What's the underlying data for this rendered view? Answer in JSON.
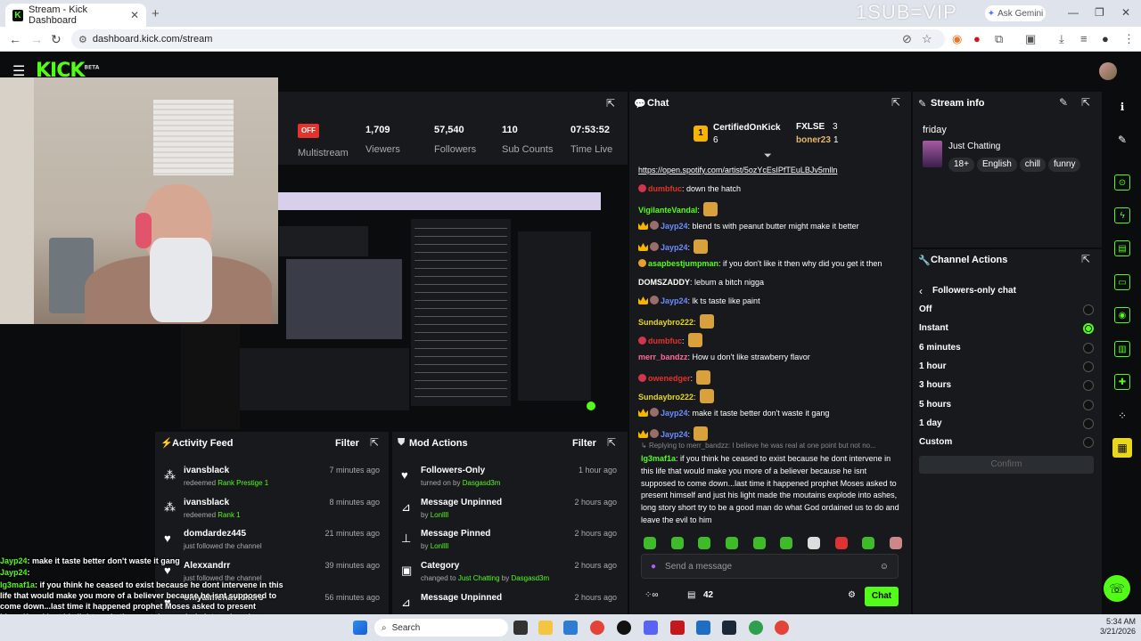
{
  "browser": {
    "tab_title": "Stream - Kick Dashboard",
    "url": "dashboard.kick.com/stream",
    "overlay_text": "1SUB=VIP",
    "gemini_label": "Ask Gemini"
  },
  "kick": {
    "logo": "KICK",
    "logo_sup": "BETA"
  },
  "stats": [
    {
      "value": "OFF",
      "label": "Multistream"
    },
    {
      "value": "1,709",
      "label": "Viewers"
    },
    {
      "value": "57,540",
      "label": "Followers"
    },
    {
      "value": "110",
      "label": "Sub Counts"
    },
    {
      "value": "07:53:52",
      "label": "Time Live"
    }
  ],
  "activity_feed": {
    "title": "Activity Feed",
    "filter": "Filter",
    "items": [
      {
        "name": "ivansblack",
        "time": "7 minutes ago",
        "sub_prefix": "redeemed",
        "sub_highlight": "Rank Prestige 1",
        "icon": "redeem-icon"
      },
      {
        "name": "ivansblack",
        "time": "8 minutes ago",
        "sub_prefix": "redeemed",
        "sub_highlight": "Rank 1",
        "icon": "redeem-icon"
      },
      {
        "name": "domdardez445",
        "time": "21 minutes ago",
        "sub_prefix": "just followed the channel",
        "sub_highlight": "",
        "icon": "heart-icon"
      },
      {
        "name": "Alexxandrr",
        "time": "39 minutes ago",
        "sub_prefix": "just followed the channel",
        "sub_highlight": "",
        "icon": "heart-icon"
      },
      {
        "name": "onlyaimenavickers",
        "time": "56 minutes ago",
        "sub_prefix": "",
        "sub_highlight": "",
        "icon": "heart-icon"
      }
    ]
  },
  "mod_actions": {
    "title": "Mod Actions",
    "filter": "Filter",
    "items": [
      {
        "name": "Followers-Only",
        "time": "1 hour ago",
        "sub_prefix": "turned on by",
        "sub_highlight": "Dasgasd3m",
        "sub_mid": "",
        "sub_highlight2": ""
      },
      {
        "name": "Message Unpinned",
        "time": "2 hours ago",
        "sub_prefix": "by",
        "sub_highlight": "Lonllll",
        "sub_mid": "",
        "sub_highlight2": ""
      },
      {
        "name": "Message Pinned",
        "time": "2 hours ago",
        "sub_prefix": "by",
        "sub_highlight": "Lonllll",
        "sub_mid": "",
        "sub_highlight2": ""
      },
      {
        "name": "Category",
        "time": "2 hours ago",
        "sub_prefix": "changed to",
        "sub_highlight": "Just Chatting",
        "sub_mid": "by",
        "sub_highlight2": "Dasgasd3m"
      },
      {
        "name": "Message Unpinned",
        "time": "2 hours ago",
        "sub_prefix": "",
        "sub_highlight": "",
        "sub_mid": "",
        "sub_highlight2": ""
      }
    ]
  },
  "overlay_chat": [
    {
      "user": "Jayp24",
      "text": ": make it taste better don't waste it gang"
    },
    {
      "user": "Jayp24",
      "text": ":"
    },
    {
      "user": "lg3maf1a",
      "text": ": if you think he ceased to exist because he dont intervene in this life that would make you more of a believer because he isnt supposed to come down...last time it happened prophet Moses asked to present himself and just his light made the moutains explode into ashes, long story short try to be a good man do what God ordained us to do and leave the evil to him"
    }
  ],
  "chat": {
    "title": "Chat",
    "top": [
      {
        "rank": "1",
        "name": "CertifiedOnKick",
        "count": "6"
      },
      {
        "name": "FXLSE",
        "count": "3"
      },
      {
        "name": "boner23",
        "count": "1"
      }
    ],
    "messages": [
      {
        "user": "",
        "color": "#ffffff",
        "text": "https://open.spotify.com/artist/5ozYcEsIPfTEuLBJv5mlln",
        "link": true
      },
      {
        "user": "dumbfuc",
        "color": "#e5322b",
        "text": ": down the hatch"
      },
      {
        "user": "VigilanteVandal",
        "color": "#53fc18",
        "text": ":"
      },
      {
        "user": "Jayp24",
        "color": "#6f8cff",
        "text": ": blend ts with peanut butter might make it better"
      },
      {
        "user": "Jayp24",
        "color": "#6f8cff",
        "text": ":"
      },
      {
        "user": "asapbestjumpman",
        "color": "#53fc18",
        "text": ": if you don't like it then why did you get it then"
      },
      {
        "user": "DOMSZADDY",
        "color": "#ffffff",
        "text": ": lebum a bitch nigga"
      },
      {
        "user": "Jayp24",
        "color": "#6f8cff",
        "text": ": lk ts taste like paint"
      },
      {
        "user": "Sundaybro222",
        "color": "#e8d71a",
        "text": ":"
      },
      {
        "user": "dumbfuc",
        "color": "#e5322b",
        "text": ":"
      },
      {
        "user": "merr_bandzz",
        "color": "#ff6b9a",
        "text": ": How u don't like strawberry flavor"
      },
      {
        "user": "owenedger",
        "color": "#e5322b",
        "text": ":"
      },
      {
        "user": "Sundaybro222",
        "color": "#e8d71a",
        "text": ":"
      },
      {
        "user": "Jayp24",
        "color": "#6f8cff",
        "text": ": make it taste better don't waste it gang"
      },
      {
        "user": "Jayp24",
        "color": "#6f8cff",
        "text": ":"
      }
    ],
    "reply_to": "Replying to merr_bandzz: I believe he was real at one point but not no...",
    "final_user": "lg3maf1a",
    "final_text": ": if you think he ceased to exist because he dont intervene in this life that would make you more of a believer because he isnt supposed to come down...last time it happened prophet Moses asked to present himself and just his light made the moutains explode into ashes, long story short try to be a good man do what God ordained us to do and leave the evil to him",
    "send_placeholder": "Send a message",
    "footer_count": "42",
    "chat_button": "Chat"
  },
  "stream_info": {
    "title": "Stream info",
    "stream_title": "friday",
    "category": "Just Chatting",
    "tags": [
      "18+",
      "English",
      "chill",
      "funny"
    ]
  },
  "channel_actions": {
    "title": "Channel Actions",
    "sub_title": "Followers-only chat",
    "options": [
      "Off",
      "Instant",
      "6 minutes",
      "1 hour",
      "3 hours",
      "5 hours",
      "1 day",
      "Custom"
    ],
    "selected": "Instant",
    "confirm": "Confirm"
  },
  "taskbar": {
    "search": "Search",
    "time": "5:34 AM",
    "date": "3/21/2026"
  },
  "colors": {
    "accent": "#53fc18",
    "panel": "#17191c",
    "bg": "#0b0c0d"
  }
}
